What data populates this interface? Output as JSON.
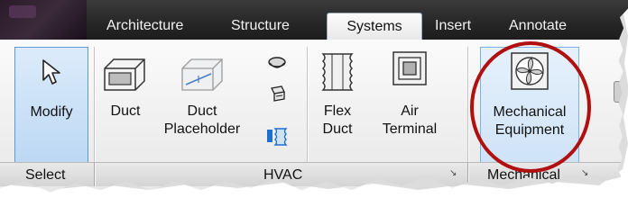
{
  "tabs": [
    {
      "label": "Architecture",
      "active": false
    },
    {
      "label": "Structure",
      "active": false
    },
    {
      "label": "Systems",
      "active": true
    },
    {
      "label": "Insert",
      "active": false
    },
    {
      "label": "Annotate",
      "active": false
    }
  ],
  "buttons": {
    "modify": "Modify",
    "duct": "Duct",
    "duct_placeholder_line1": "Duct",
    "duct_placeholder_line2": "Placeholder",
    "flex_duct_line1": "Flex",
    "flex_duct_line2": "Duct",
    "air_terminal_line1": "Air",
    "air_terminal_line2": "Terminal",
    "mech_equipment_line1": "Mechanical",
    "mech_equipment_line2": "Equipment"
  },
  "groups": {
    "select": "Select",
    "hvac": "HVAC",
    "mechanical": "Mechanical"
  },
  "launcher_glyph": "↘",
  "icons": {
    "modify": "cursor-arrow-icon",
    "duct": "duct-icon",
    "duct_placeholder": "duct-placeholder-icon",
    "duct_fitting": "duct-fitting-icon",
    "duct_accessory": "duct-accessory-icon",
    "convert_flex": "convert-to-flex-icon",
    "flex_duct": "flex-duct-icon",
    "air_terminal": "air-terminal-icon",
    "mech_equipment": "fan-equipment-icon"
  },
  "colors": {
    "highlight_circle": "#b01010",
    "selection_border": "#5b9bd9",
    "tabbar": "#262626"
  }
}
